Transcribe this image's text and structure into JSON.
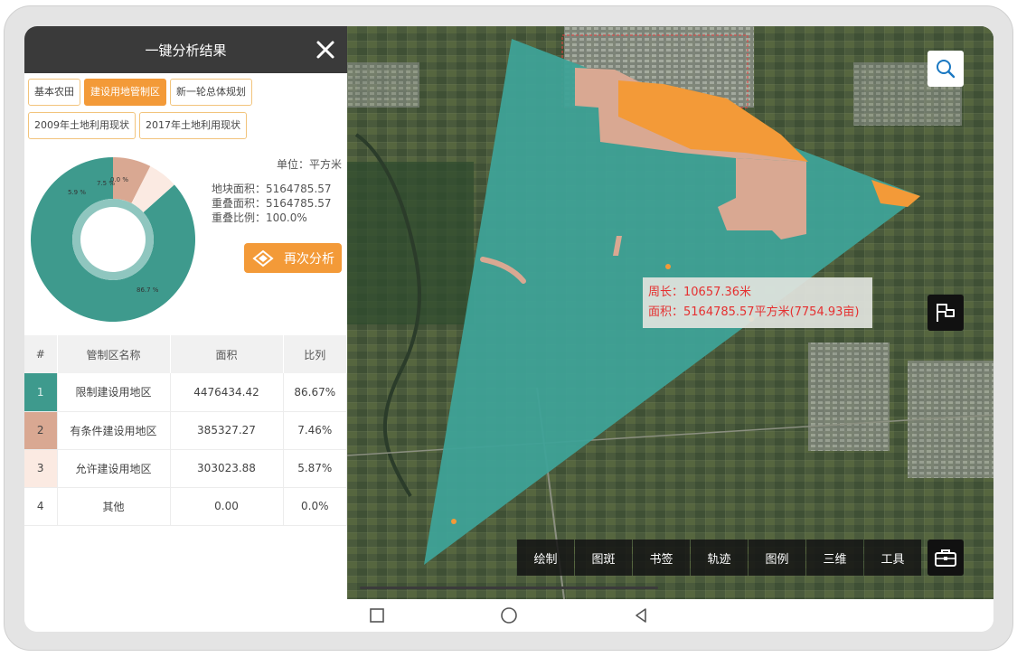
{
  "panel": {
    "title": "一键分析结果",
    "tabs": [
      {
        "label": "基本农田",
        "active": false
      },
      {
        "label": "建设用地管制区",
        "active": true
      },
      {
        "label": "新一轮总体规划",
        "active": false
      },
      {
        "label": "2009年土地利用现状",
        "active": false
      },
      {
        "label": "2017年土地利用现状",
        "active": false
      }
    ],
    "unit": "单位：平方米",
    "stats": {
      "parcel_area": "地块面积：5164785.57",
      "overlap_area": "重叠面积：5164785.57",
      "overlap_ratio": "重叠比例：100.0%"
    },
    "reanalyze_label": "再次分析",
    "donut_labels": {
      "s1": "86.7 %",
      "s2": "7.5 %",
      "s3": "5.9 %",
      "s4": "0.0 %"
    }
  },
  "table": {
    "headers": [
      "#",
      "管制区名称",
      "面积",
      "比列"
    ],
    "rows": [
      {
        "idx": "1",
        "name": "限制建设用地区",
        "area": "4476434.42",
        "ratio": "86.67%",
        "color": "#3e9a8d"
      },
      {
        "idx": "2",
        "name": "有条件建设用地区",
        "area": "385327.27",
        "ratio": "7.46%",
        "color": "#d9a892"
      },
      {
        "idx": "3",
        "name": "允许建设用地区",
        "area": "303023.88",
        "ratio": "5.87%",
        "color": "#fbeae2"
      },
      {
        "idx": "4",
        "name": "其他",
        "area": "0.00",
        "ratio": "0.0%",
        "color": "#ffffff"
      }
    ]
  },
  "chart_data": {
    "type": "pie",
    "categories": [
      "限制建设用地区",
      "有条件建设用地区",
      "允许建设用地区",
      "其他"
    ],
    "values": [
      86.7,
      7.5,
      5.9,
      0.0
    ],
    "colors": [
      "#3e9a8d",
      "#d9a892",
      "#fbeae2",
      "#ffffff"
    ],
    "title": "",
    "xlabel": "",
    "ylabel": ""
  },
  "map": {
    "measure": {
      "perimeter": "周长：10657.36米",
      "area": "面积：5164785.57平方米(7754.93亩)"
    },
    "toolbar": [
      "绘制",
      "图斑",
      "书签",
      "轨迹",
      "图例",
      "三维",
      "工具"
    ]
  },
  "icons": {
    "close": "close-icon",
    "search": "search-icon",
    "flag": "flag-icon",
    "toolbox": "toolbox-icon",
    "reanalyze": "analyze-icon"
  }
}
